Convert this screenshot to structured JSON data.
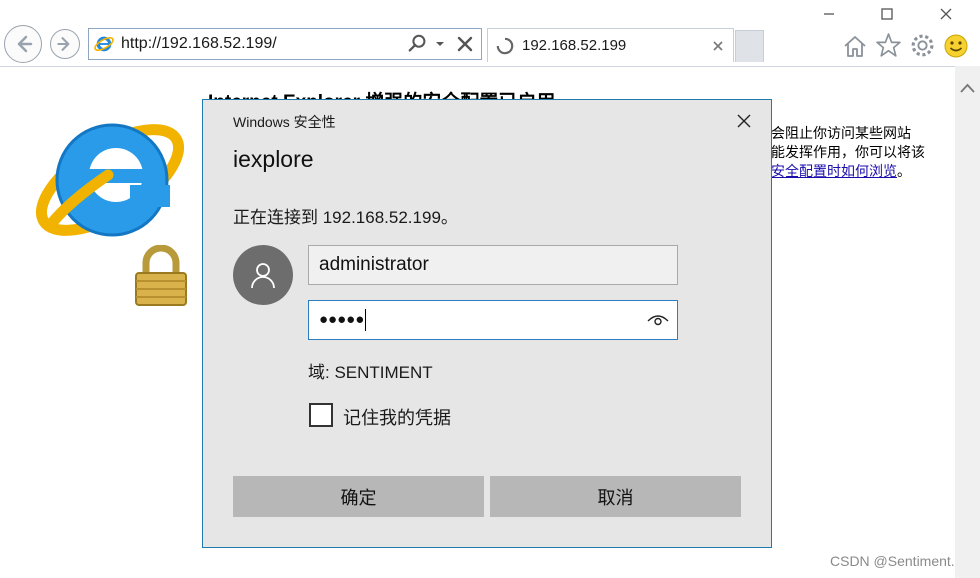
{
  "browser": {
    "address": "http://192.168.52.199/",
    "tab_title": "192.168.52.199"
  },
  "page": {
    "heading": "Internet Explorer 增强的安全配置已启用",
    "text_line1": "会阻止你访问某些网站",
    "text_line2": "能发挥作用，你可以将该",
    "link_text": "安全配置时如何浏览",
    "link_suffix": "。"
  },
  "dialog": {
    "title": "Windows 安全性",
    "app_name": "iexplore",
    "message": "正在连接到 192.168.52.199。",
    "username": "administrator",
    "password_mask": "●●●●●",
    "domain_label": "域: SENTIMENT",
    "remember_label": "记住我的凭据",
    "remember_checked": false,
    "ok_label": "确定",
    "cancel_label": "取消"
  },
  "watermark": "CSDN @Sentiment.",
  "colors": {
    "dialog_border": "#1f7ab0",
    "dialog_bg": "#e6e6e6",
    "button_bg": "#b7b7b7",
    "link": "#1a0dab"
  }
}
